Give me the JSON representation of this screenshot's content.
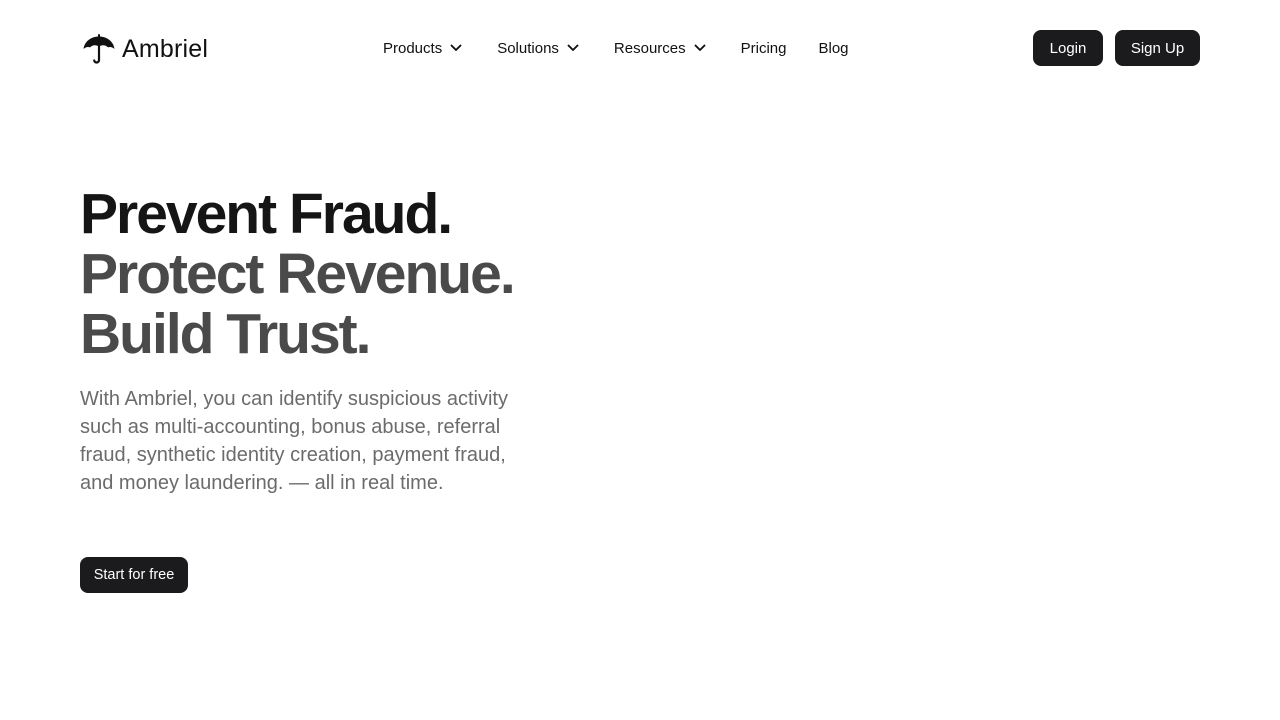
{
  "brand": {
    "name": "Ambriel",
    "logo_icon": "umbrella-icon"
  },
  "nav": {
    "items": [
      {
        "label": "Products",
        "has_dropdown": true
      },
      {
        "label": "Solutions",
        "has_dropdown": true
      },
      {
        "label": "Resources",
        "has_dropdown": true
      },
      {
        "label": "Pricing",
        "has_dropdown": false
      },
      {
        "label": "Blog",
        "has_dropdown": false
      }
    ],
    "dropdown_icon": "chevron-down-icon"
  },
  "auth": {
    "login_label": "Login",
    "signup_label": "Sign Up"
  },
  "hero": {
    "headline_lines": [
      "Prevent Fraud.",
      "Protect Revenue.",
      "Build Trust."
    ],
    "description": "With Ambriel, you can identify suspicious activity such as multi-accounting, bonus abuse, referral fraud, synthetic identity creation, payment fraud, and money laundering. — all in real time.",
    "cta_label": "Start for free"
  },
  "colors": {
    "button_bg": "#1b1b1d",
    "headline_primary": "#151515",
    "headline_secondary": "#4a4a4a",
    "body_text": "#6b6b6b",
    "background": "#ffffff"
  }
}
